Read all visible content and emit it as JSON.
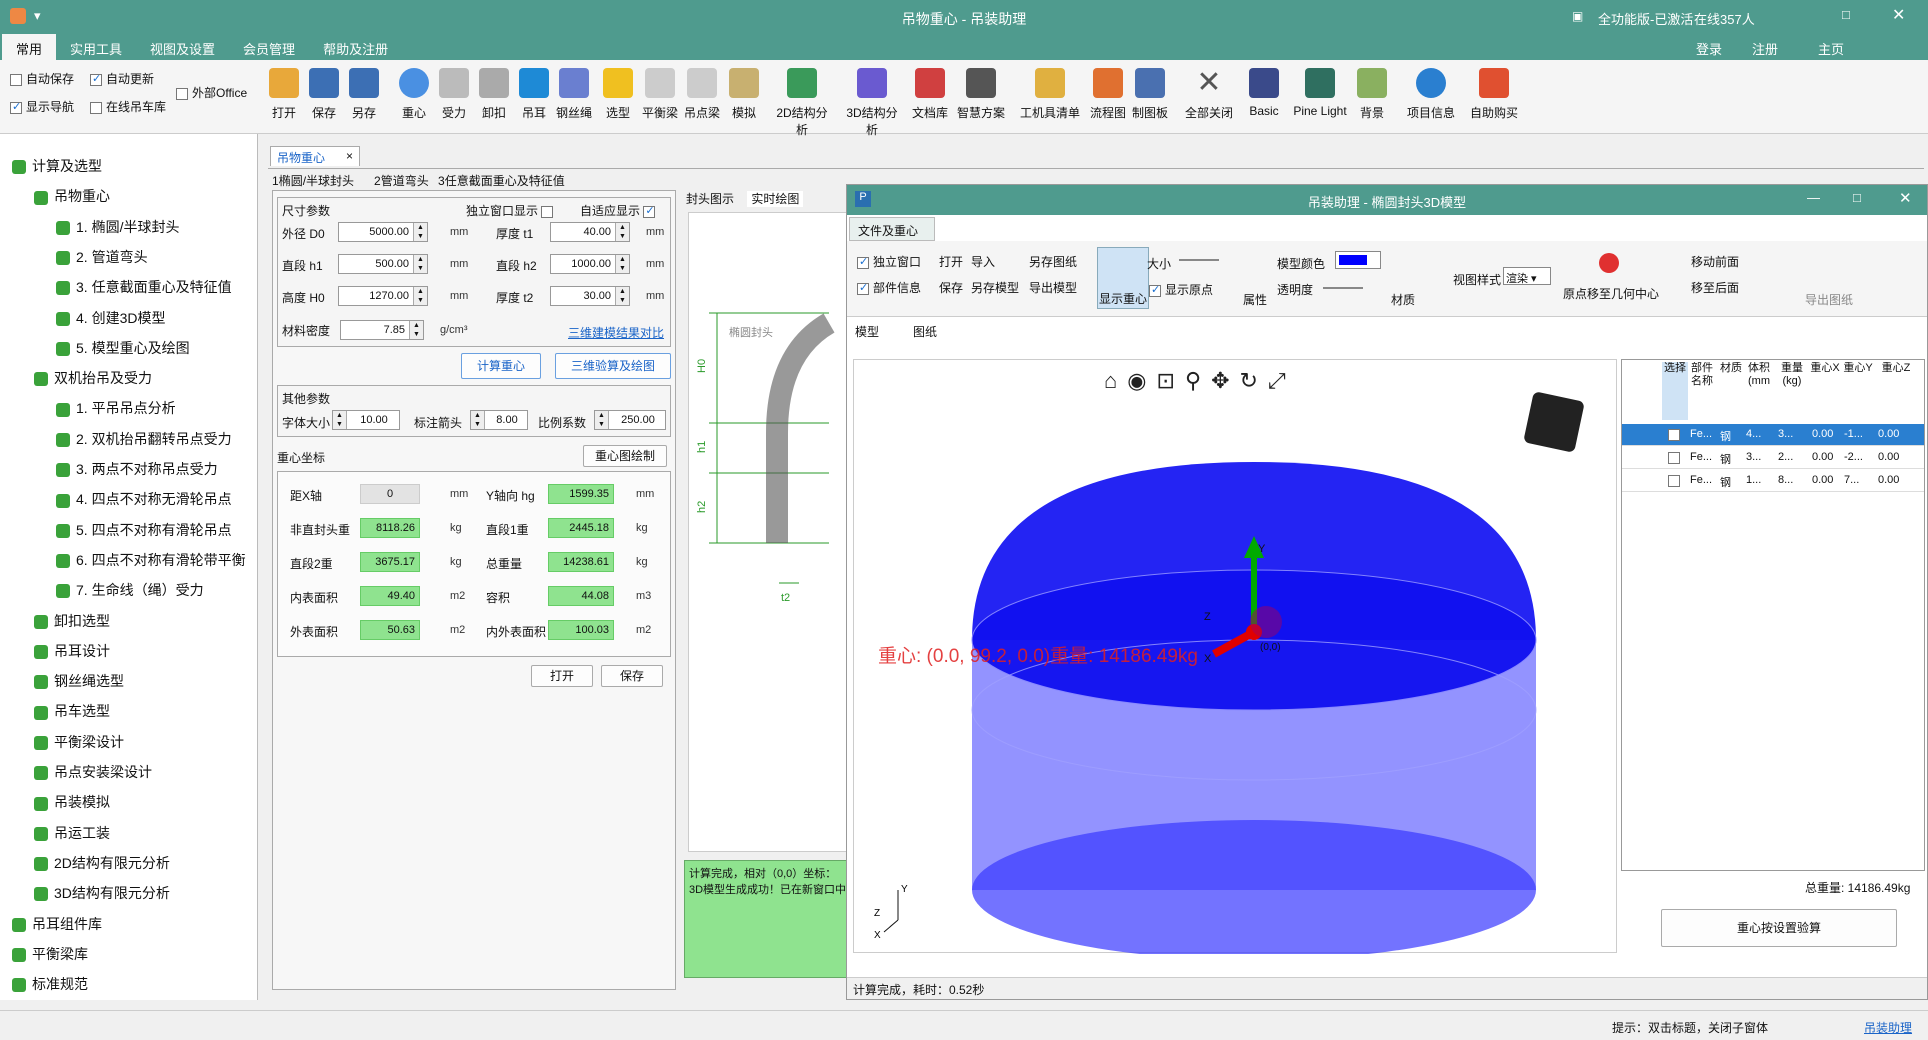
{
  "app": {
    "title": "吊物重心 - 吊装助理",
    "license": "全功能版-已激活",
    "online": "在线357人"
  },
  "menus": [
    "常用",
    "实用工具",
    "视图及设置",
    "会员管理",
    "帮助及注册"
  ],
  "account": {
    "login": "登录",
    "register": "注册",
    "home": "主页"
  },
  "options": {
    "autosave": "自动保存",
    "autoupdate": "自动更新",
    "show_nav": "显示导航",
    "online_crane": "在线吊车库",
    "external_office": "外部Office"
  },
  "ribbon": [
    "打开",
    "保存",
    "另存",
    "重心",
    "受力",
    "卸扣",
    "吊耳",
    "钢丝绳",
    "选型",
    "平衡梁",
    "吊点梁",
    "模拟",
    "2D结构分析",
    "3D结构分析",
    "文档库",
    "智慧方案",
    "工机具清单",
    "流程图",
    "制图板",
    "全部关闭",
    "Basic",
    "Pine Light",
    "背景",
    "项目信息",
    "自助购买"
  ],
  "tree": [
    {
      "t": "计算及选型",
      "l": 0
    },
    {
      "t": "吊物重心",
      "l": 1
    },
    {
      "t": "1. 椭圆/半球封头",
      "l": 2
    },
    {
      "t": "2. 管道弯头",
      "l": 2
    },
    {
      "t": "3. 任意截面重心及特征值",
      "l": 2
    },
    {
      "t": "4. 创建3D模型",
      "l": 2
    },
    {
      "t": "5. 模型重心及绘图",
      "l": 2
    },
    {
      "t": "双机抬吊及受力",
      "l": 1
    },
    {
      "t": "1. 平吊吊点分析",
      "l": 2
    },
    {
      "t": "2. 双机抬吊翻转吊点受力",
      "l": 2
    },
    {
      "t": "3. 两点不对称吊点受力",
      "l": 2
    },
    {
      "t": "4. 四点不对称无滑轮吊点",
      "l": 2
    },
    {
      "t": "5. 四点不对称有滑轮吊点",
      "l": 2
    },
    {
      "t": "6. 四点不对称有滑轮带平衡",
      "l": 2
    },
    {
      "t": "7. 生命线（绳）受力",
      "l": 2
    },
    {
      "t": "卸扣选型",
      "l": 1
    },
    {
      "t": "吊耳设计",
      "l": 1
    },
    {
      "t": "钢丝绳选型",
      "l": 1
    },
    {
      "t": "吊车选型",
      "l": 1
    },
    {
      "t": "平衡梁设计",
      "l": 1
    },
    {
      "t": "吊点安装梁设计",
      "l": 1
    },
    {
      "t": "吊装模拟",
      "l": 1
    },
    {
      "t": "吊运工装",
      "l": 1
    },
    {
      "t": "2D结构有限元分析",
      "l": 1
    },
    {
      "t": "3D结构有限元分析",
      "l": 1
    },
    {
      "t": "吊耳组件库",
      "l": 0
    },
    {
      "t": "平衡梁库",
      "l": 0
    },
    {
      "t": "标准规范",
      "l": 0
    }
  ],
  "doc_tab": "吊物重心",
  "sub_tabs": [
    "椭圆/半球封头",
    "管道弯头",
    "任意截面重心及特征值"
  ],
  "size": {
    "title": "尺寸参数",
    "indep": "独立窗口显示",
    "adaptive": "自适应显示",
    "rows": [
      {
        "l": "外径 D0",
        "v": "5000.00",
        "u": "mm",
        "l2": "厚度 t1",
        "v2": "40.00",
        "u2": "mm"
      },
      {
        "l": "直段 h1",
        "v": "500.00",
        "u": "mm",
        "l2": "直段 h2",
        "v2": "1000.00",
        "u2": "mm"
      },
      {
        "l": "高度 H0",
        "v": "1270.00",
        "u": "mm",
        "l2": "厚度 t2",
        "v2": "30.00",
        "u2": "mm"
      }
    ],
    "density_label": "材料密度",
    "density": "7.85",
    "density_unit": "g/cm³",
    "compare_link": "三维建模结果对比"
  },
  "buttons": {
    "calc": "计算重心",
    "verify": "三维验算及绘图",
    "cg_draw": "重心图绘制",
    "open": "打开",
    "save": "保存"
  },
  "other": {
    "title": "其他参数",
    "font_l": "字体大小",
    "font": "10.00",
    "arrow_l": "标注箭头",
    "arrow": "8.00",
    "scale_l": "比例系数",
    "scale": "250.00"
  },
  "cg": {
    "title": "重心坐标",
    "rows": [
      {
        "l": "距X轴",
        "v": "0",
        "u": "mm",
        "l2": "Y轴向 hg",
        "v2": "1599.35",
        "u2": "mm"
      },
      {
        "l": "非直封头重",
        "v": "8118.26",
        "u": "kg",
        "l2": "直段1重",
        "v2": "2445.18",
        "u2": "kg"
      },
      {
        "l": "直段2重",
        "v": "3675.17",
        "u": "kg",
        "l2": "总重量",
        "v2": "14238.61",
        "u2": "kg"
      },
      {
        "l": "内表面积",
        "v": "49.40",
        "u": "m2",
        "l2": "容积",
        "v2": "44.08",
        "u2": "m3"
      },
      {
        "l": "外表面积",
        "v": "50.63",
        "u": "m2",
        "l2": "内外表面积",
        "v2": "100.03",
        "u2": "m2"
      }
    ]
  },
  "drawing_tabs": [
    "封头图示",
    "实时绘图"
  ],
  "drawing_labels": {
    "name": "椭圆封头",
    "h0": "H0",
    "h1": "h1",
    "h2": "h2",
    "t2": "t2"
  },
  "log": [
    "计算完成，相对（0,0）坐标：",
    "3D模型生成成功！已在新窗口中"
  ],
  "win2": {
    "title": "吊装助理 - 椭圆封头3D模型",
    "tab": "文件及重心",
    "indep": "独立窗口",
    "part_info": "部件信息",
    "open": "打开",
    "import": "导入",
    "save_as_drawing": "另存图纸",
    "save": "保存",
    "save_model": "另存模型",
    "export_model": "导出模型",
    "show_cg": "显示重心",
    "size": "大小",
    "show_origin": "显示原点",
    "attr": "属性",
    "model_color": "模型颜色",
    "transparency": "透明度",
    "material": "材质",
    "view_style_l": "视图样式",
    "view_style": "渲染",
    "origin_move": "原点移至几何中心",
    "move_front": "移动前面",
    "move_back": "移至后面",
    "export_drawing": "导出图纸",
    "view_tabs": [
      "模型",
      "图纸"
    ],
    "cg_label": "重心: (0.0, 99.2, 0.0)重量: 14186.49kg",
    "origin": "(0,0)",
    "axis_x": "X",
    "axis_y": "Y",
    "axis_z": "Z",
    "headers": [
      "选择",
      "部件名称",
      "材质",
      "体积(mm",
      "重量(kg)",
      "重心X",
      "重心Y",
      "重心Z"
    ],
    "rows": [
      [
        "Fe...",
        "钢",
        "4...",
        "3...",
        "0.00",
        "-1...",
        "0.00"
      ],
      [
        "Fe...",
        "钢",
        "3...",
        "2...",
        "0.00",
        "-2...",
        "0.00"
      ],
      [
        "Fe...",
        "钢",
        "1...",
        "8...",
        "0.00",
        "7...",
        "0.00"
      ]
    ],
    "total": "总重量: 14186.49kg",
    "set_btn": "重心按设置验算",
    "status": "计算完成，耗时：0.52秒"
  },
  "statusbar": {
    "hint": "提示：双击标题，关闭子窗体",
    "brand": "吊装助理"
  }
}
